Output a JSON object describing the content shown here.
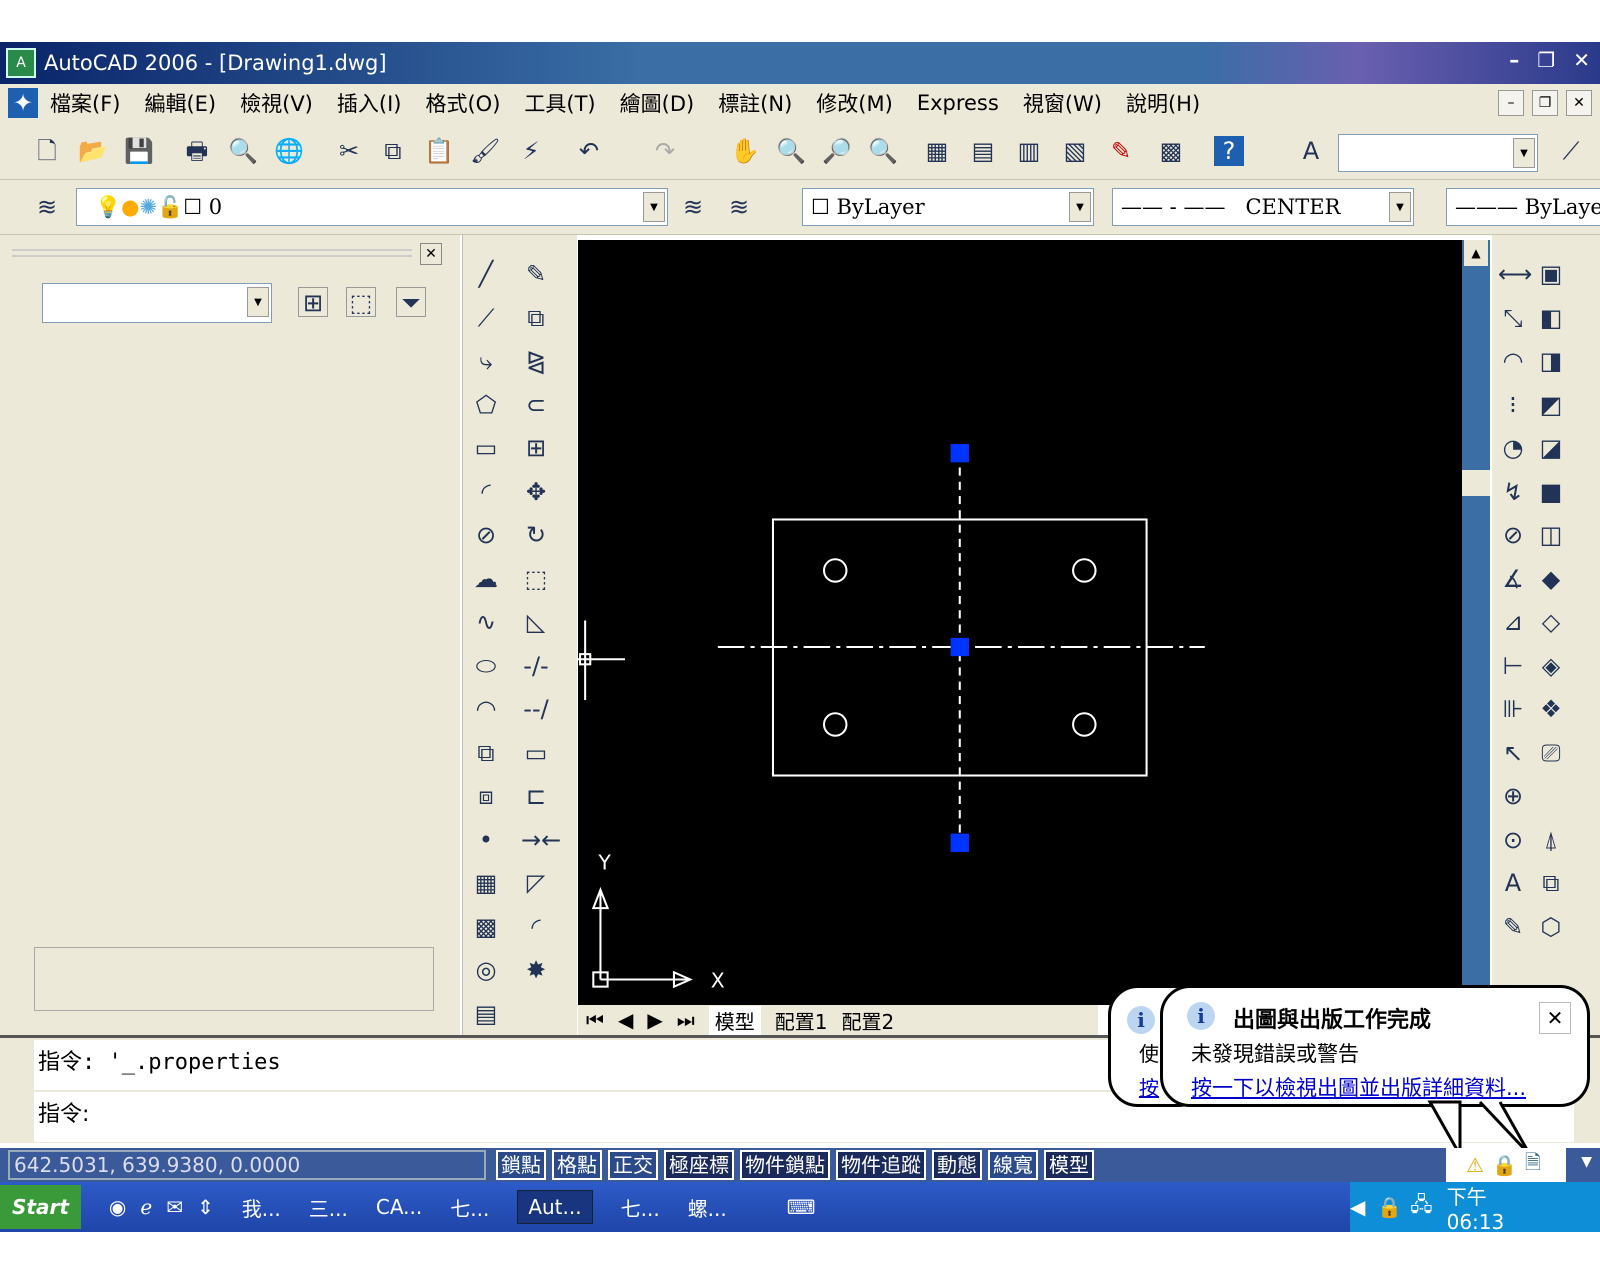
{
  "window": {
    "title": "AutoCAD 2006 - [Drawing1.dwg]",
    "min": "–",
    "restore": "❐",
    "close": "✕"
  },
  "menu": [
    "檔案(F)",
    "編輯(E)",
    "檢視(V)",
    "插入(I)",
    "格式(O)",
    "工具(T)",
    "繪圖(D)",
    "標註(N)",
    "修改(M)",
    "Express",
    "視窗(W)",
    "說明(H)"
  ],
  "doc_buttons": [
    "–",
    "❐",
    "✕"
  ],
  "toolbar": {
    "layer_value": "0",
    "color_value": "ByLayer",
    "linetype_value": "CENTER",
    "lineweight_value": "ByLayer"
  },
  "properties_panel": {
    "close": "✕"
  },
  "canvas": {
    "ucs_x": "X",
    "ucs_y": "Y",
    "background": "#000000",
    "grip_color": "#0033ff"
  },
  "layout_tabs": [
    "模型",
    "配置1",
    "配置2"
  ],
  "command": {
    "line1": "指令:  '_.properties",
    "line2": "指令:"
  },
  "status": {
    "coords": "642.5031, 639.9380, 0.0000",
    "buttons": [
      "鎖點",
      "格點",
      "正交",
      "極座標",
      "物件鎖點",
      "物件追蹤",
      "動態",
      "線寬",
      "模型"
    ]
  },
  "balloon": {
    "title": "出圖與出版工作完成",
    "message": "未發現錯誤或警告",
    "link": "按一下以檢視出圖並出版詳細資料...",
    "close": "✕",
    "behind_line1": "使",
    "behind_line2": "按"
  },
  "taskbar": {
    "start": "Start",
    "items": [
      "我...",
      "三...",
      "CA...",
      "七...",
      "Aut...",
      "七...",
      "螺..."
    ],
    "clock": "下午 06:13"
  }
}
